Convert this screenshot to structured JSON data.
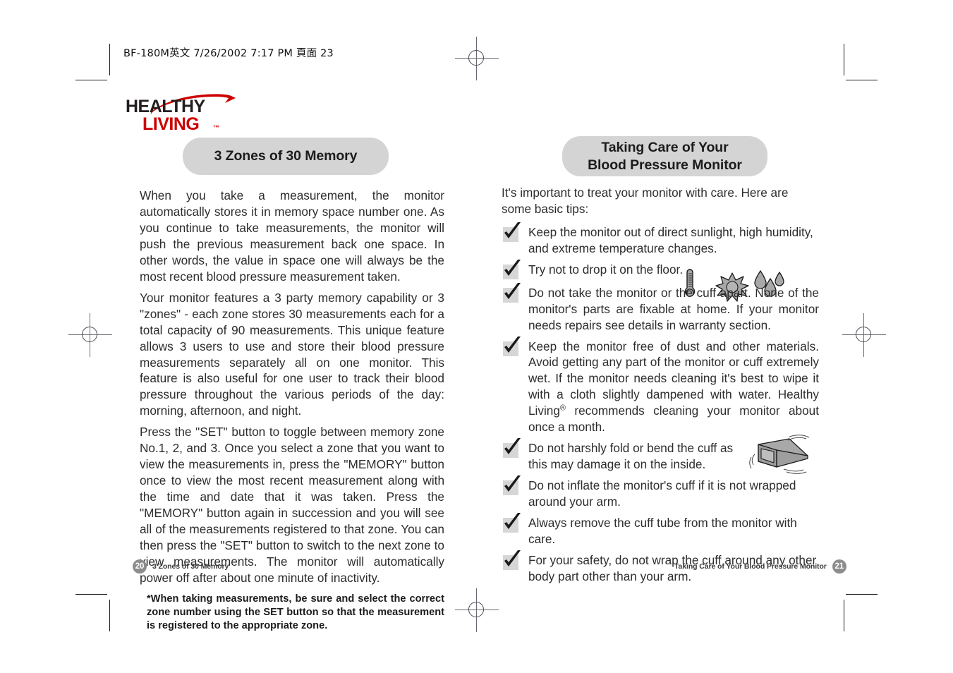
{
  "print_header": {
    "file_line": "BF-180M英文  7/26/2002  7:17 PM  頁面 23"
  },
  "logo": {
    "line1": "HEALTHY",
    "line2": "LIVING",
    "tm": "™",
    "color_primary": "#231f20",
    "color_accent": "#cc0000"
  },
  "left_page": {
    "title": "3 Zones of 30 Memory",
    "paragraphs": [
      "When you take a measurement, the monitor automatically stores it in memory space number one. As you continue to take measurements, the monitor will push the previous measurement back one space. In other words, the value in space one will always be the most recent blood pressure measurement taken.",
      "Your monitor features a 3 party memory capability or 3 \"zones\" - each zone stores 30 measurements each for a total capacity of 90 measurements. This unique feature allows 3 users to use and store their blood pressure measurements separately all on one monitor. This feature is also useful for one user to track their blood pressure throughout the various periods of the day: morning, afternoon, and night.",
      "Press the \"SET\" button to toggle between memory zone No.1, 2, and 3. Once you select a zone that you want to view the measurements in, press the \"MEMORY\" button once to view the most recent measurement along with the time and date that it was taken. Press the \"MEMORY\" button again in succession and you will see all of the measurements registered to that zone. You can then press the \"SET\" button to switch to the next zone to view measurements. The monitor will automatically power off after about one minute of inactivity."
    ],
    "note": "*When taking measurements, be sure and select the correct zone number using the SET button so that the measurement is registered to the appropriate zone.",
    "footer": {
      "page_number": "20",
      "section": "3 Zones of 30 Memory"
    }
  },
  "right_page": {
    "title_line1": "Taking Care of Your",
    "title_line2": "Blood Pressure Monitor",
    "intro": "It's important to treat your monitor with care. Here are some basic tips:",
    "tips": [
      {
        "text": "Keep the monitor out of direct sunlight, high humidity, and extreme temperature changes.",
        "icons": [
          "thermometer-icon",
          "sun-icon",
          "water-drops-icon"
        ]
      },
      {
        "text": "Try not to drop it on the floor.",
        "icons": []
      },
      {
        "text": "Do not take the monitor or the cuff apart. None of the monitor's parts are fixable at home. If your monitor needs repairs see details in warranty section.",
        "icons": []
      },
      {
        "text_before_mark": "Keep the monitor free of dust and other materials. Avoid getting any part of the monitor or cuff extremely wet. If  the monitor needs cleaning it's best to wipe it with a cloth slightly dampened with water. Healthy Living",
        "mark": "®",
        "text_after_mark": "  recommends cleaning your monitor about once a month.",
        "icons": []
      },
      {
        "text": "Do not harshly fold or bend the cuff as this may damage it on the inside.",
        "icons": [
          "cuff-icon"
        ]
      },
      {
        "text": "Do not inflate the monitor's cuff if it is not wrapped around your arm.",
        "icons": []
      },
      {
        "text": "Always remove the cuff tube from the monitor with care.",
        "icons": []
      },
      {
        "text": "For your safety, do not wrap the cuff around any other body part other than your arm.",
        "icons": []
      }
    ],
    "footer": {
      "page_number": "21",
      "section": "Taking Care of Your Blood Pressure Monitor"
    }
  },
  "colors": {
    "pill_background": "#d4d4d4",
    "checkbox_background": "#d6d6d6",
    "page_badge": "#8d8d8d",
    "body_text": "#2d2d2d"
  }
}
